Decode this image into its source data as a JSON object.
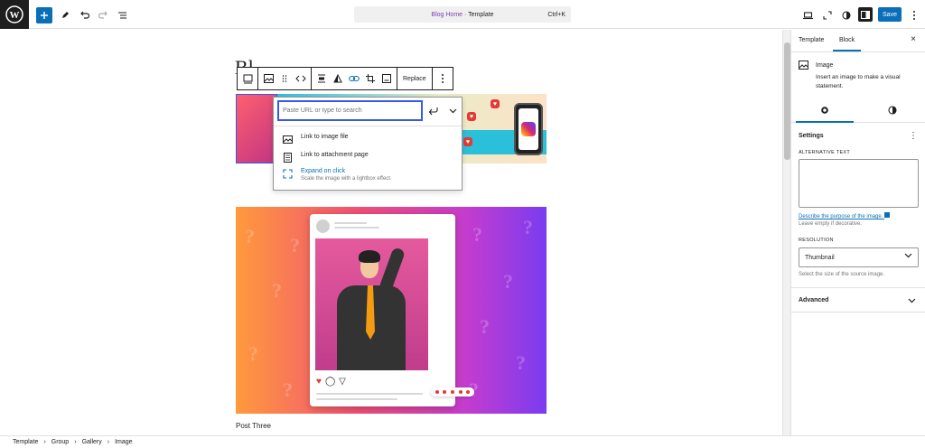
{
  "topbar": {
    "document_title_highlight": "Blog Home",
    "document_title_suffix": " · Template",
    "shortcut": "Ctrl+K",
    "save_label": "Save"
  },
  "canvas": {
    "partial_title": "Bl",
    "post_caption": "Post Three"
  },
  "block_toolbar": {
    "replace_label": "Replace"
  },
  "link_popover": {
    "placeholder": "Paste URL or type to search",
    "items": [
      {
        "label": "Link to image file",
        "icon": "image-icon"
      },
      {
        "label": "Link to attachment page",
        "icon": "page-icon"
      },
      {
        "label": "Expand on click",
        "sub": "Scale the image with a lightbox effect.",
        "icon": "fullscreen-icon"
      }
    ]
  },
  "panel": {
    "tabs": [
      "Template",
      "Block"
    ],
    "active_tab": "Block",
    "block_title": "Image",
    "block_desc": "Insert an image to make a visual statement.",
    "settings_head": "Settings",
    "alt_label": "ALTERNATIVE TEXT",
    "alt_value": "",
    "alt_help_link": "Describe the purpose of the image.",
    "alt_help": "Leave empty if decorative.",
    "resolution_label": "RESOLUTION",
    "resolution_value": "Thumbnail",
    "resolution_help": "Select the size of the source image.",
    "advanced_label": "Advanced"
  },
  "breadcrumb": [
    "Template",
    "Group",
    "Gallery",
    "Image"
  ],
  "colors": {
    "accent": "#0a6fb8",
    "highlight_title": "#7b3db4"
  }
}
